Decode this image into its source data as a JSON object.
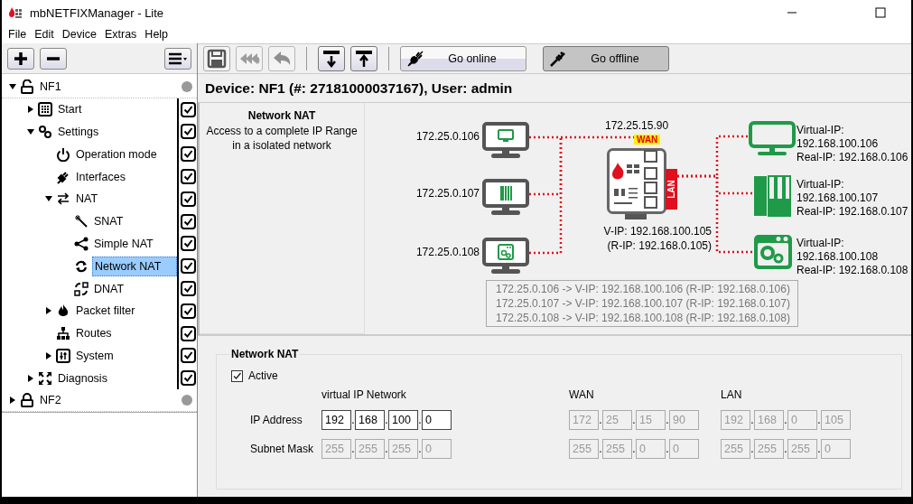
{
  "window": {
    "title": "mbNETFIXManager - Lite"
  },
  "menu": [
    "File",
    "Edit",
    "Device",
    "Extras",
    "Help"
  ],
  "tree": [
    {
      "kind": "device",
      "label": "NF1",
      "locked": false,
      "expanded": true,
      "children": [
        {
          "kind": "item",
          "label": "Start",
          "expanded": false,
          "checked": true,
          "selected": false
        },
        {
          "kind": "item",
          "label": "Settings",
          "expanded": true,
          "checked": true,
          "selected": false,
          "children": [
            {
              "kind": "item",
              "label": "Operation mode",
              "checked": true,
              "selected": false
            },
            {
              "kind": "item",
              "label": "Interfaces",
              "checked": true,
              "selected": false
            },
            {
              "kind": "item",
              "label": "NAT",
              "expanded": true,
              "checked": true,
              "selected": false,
              "children": [
                {
                  "kind": "item",
                  "label": "SNAT",
                  "checked": true,
                  "selected": false
                },
                {
                  "kind": "item",
                  "label": "Simple NAT",
                  "checked": true,
                  "selected": false
                },
                {
                  "kind": "item",
                  "label": "Network NAT",
                  "checked": true,
                  "selected": true
                },
                {
                  "kind": "item",
                  "label": "DNAT",
                  "checked": true,
                  "selected": false
                }
              ]
            },
            {
              "kind": "item",
              "label": "Packet filter",
              "expanded": false,
              "checked": true,
              "selected": false
            },
            {
              "kind": "item",
              "label": "Routes",
              "checked": true,
              "selected": false
            },
            {
              "kind": "item",
              "label": "System",
              "expanded": false,
              "checked": true,
              "selected": false
            }
          ]
        },
        {
          "kind": "item",
          "label": "Diagnosis",
          "expanded": false,
          "checked": true,
          "selected": false
        }
      ]
    },
    {
      "kind": "device",
      "label": "NF2",
      "locked": true,
      "expanded": false
    }
  ],
  "toolbar": {
    "groups": [
      [
        {
          "kind": "icon",
          "disabled": false
        },
        {
          "kind": "icon",
          "disabled": true
        },
        {
          "kind": "icon",
          "disabled": true
        }
      ],
      [
        {
          "kind": "icon",
          "disabled": false
        },
        {
          "kind": "icon",
          "disabled": false
        }
      ],
      [
        {
          "kind": "text",
          "label": "Go online",
          "selected": false
        },
        {
          "kind": "text",
          "label": "Go offline",
          "selected": true
        }
      ]
    ]
  },
  "device_header": "Device: NF1 (#: 27181000037167), User: admin",
  "diagram": {
    "title": "Network NAT",
    "description": "Access to a complete IP Range in a isolated network",
    "clients": [
      {
        "ip": "172.25.0.106"
      },
      {
        "ip": "172.25.0.107"
      },
      {
        "ip": "172.25.0.108"
      }
    ],
    "router": {
      "wan_ip": "172.25.15.90",
      "wan_label": "WAN",
      "lan_label": "LAN",
      "address_lines": [
        "V-IP: 192.168.100.105",
        "(R-IP: 192.168.0.105)"
      ]
    },
    "targets": [
      {
        "lines": [
          "Virtual-IP:",
          "192.168.100.106",
          "Real-IP: 192.168.0.106"
        ]
      },
      {
        "lines": [
          "Virtual-IP:",
          "192.168.100.107",
          "Real-IP: 192.168.0.107"
        ]
      },
      {
        "lines": [
          "Virtual-IP:",
          "192.168.100.108",
          "Real-IP: 192.168.0.108"
        ]
      }
    ],
    "mapping": [
      "172.25.0.106 -> V-IP: 192.168.100.106 (R-IP: 192.168.0.106)",
      "172.25.0.107 -> V-IP: 192.168.100.107 (R-IP: 192.168.0.107)",
      "172.25.0.108 -> V-IP: 192.168.100.108 (R-IP: 192.168.0.108)"
    ]
  },
  "form": {
    "title": "Network NAT",
    "active": {
      "label": "Active",
      "checked": true
    },
    "octet_separator": ".",
    "columns": [
      "virtual IP Network",
      "WAN",
      "LAN"
    ],
    "rows": [
      {
        "label": "IP Address",
        "groups": [
          {
            "octets": [
              "192",
              "168",
              "100",
              "0"
            ],
            "disabled": false
          },
          {
            "octets": [
              "172",
              "25",
              "15",
              "90"
            ],
            "disabled": true
          },
          {
            "octets": [
              "192",
              "168",
              "0",
              "105"
            ],
            "disabled": true
          }
        ]
      },
      {
        "label": "Subnet Mask",
        "groups": [
          {
            "octets": [
              "255",
              "255",
              "255",
              "0"
            ],
            "disabled": true
          },
          {
            "octets": [
              "255",
              "255",
              "0",
              "0"
            ],
            "disabled": true
          },
          {
            "octets": [
              "255",
              "255",
              "255",
              "0"
            ],
            "disabled": true
          }
        ]
      }
    ]
  }
}
